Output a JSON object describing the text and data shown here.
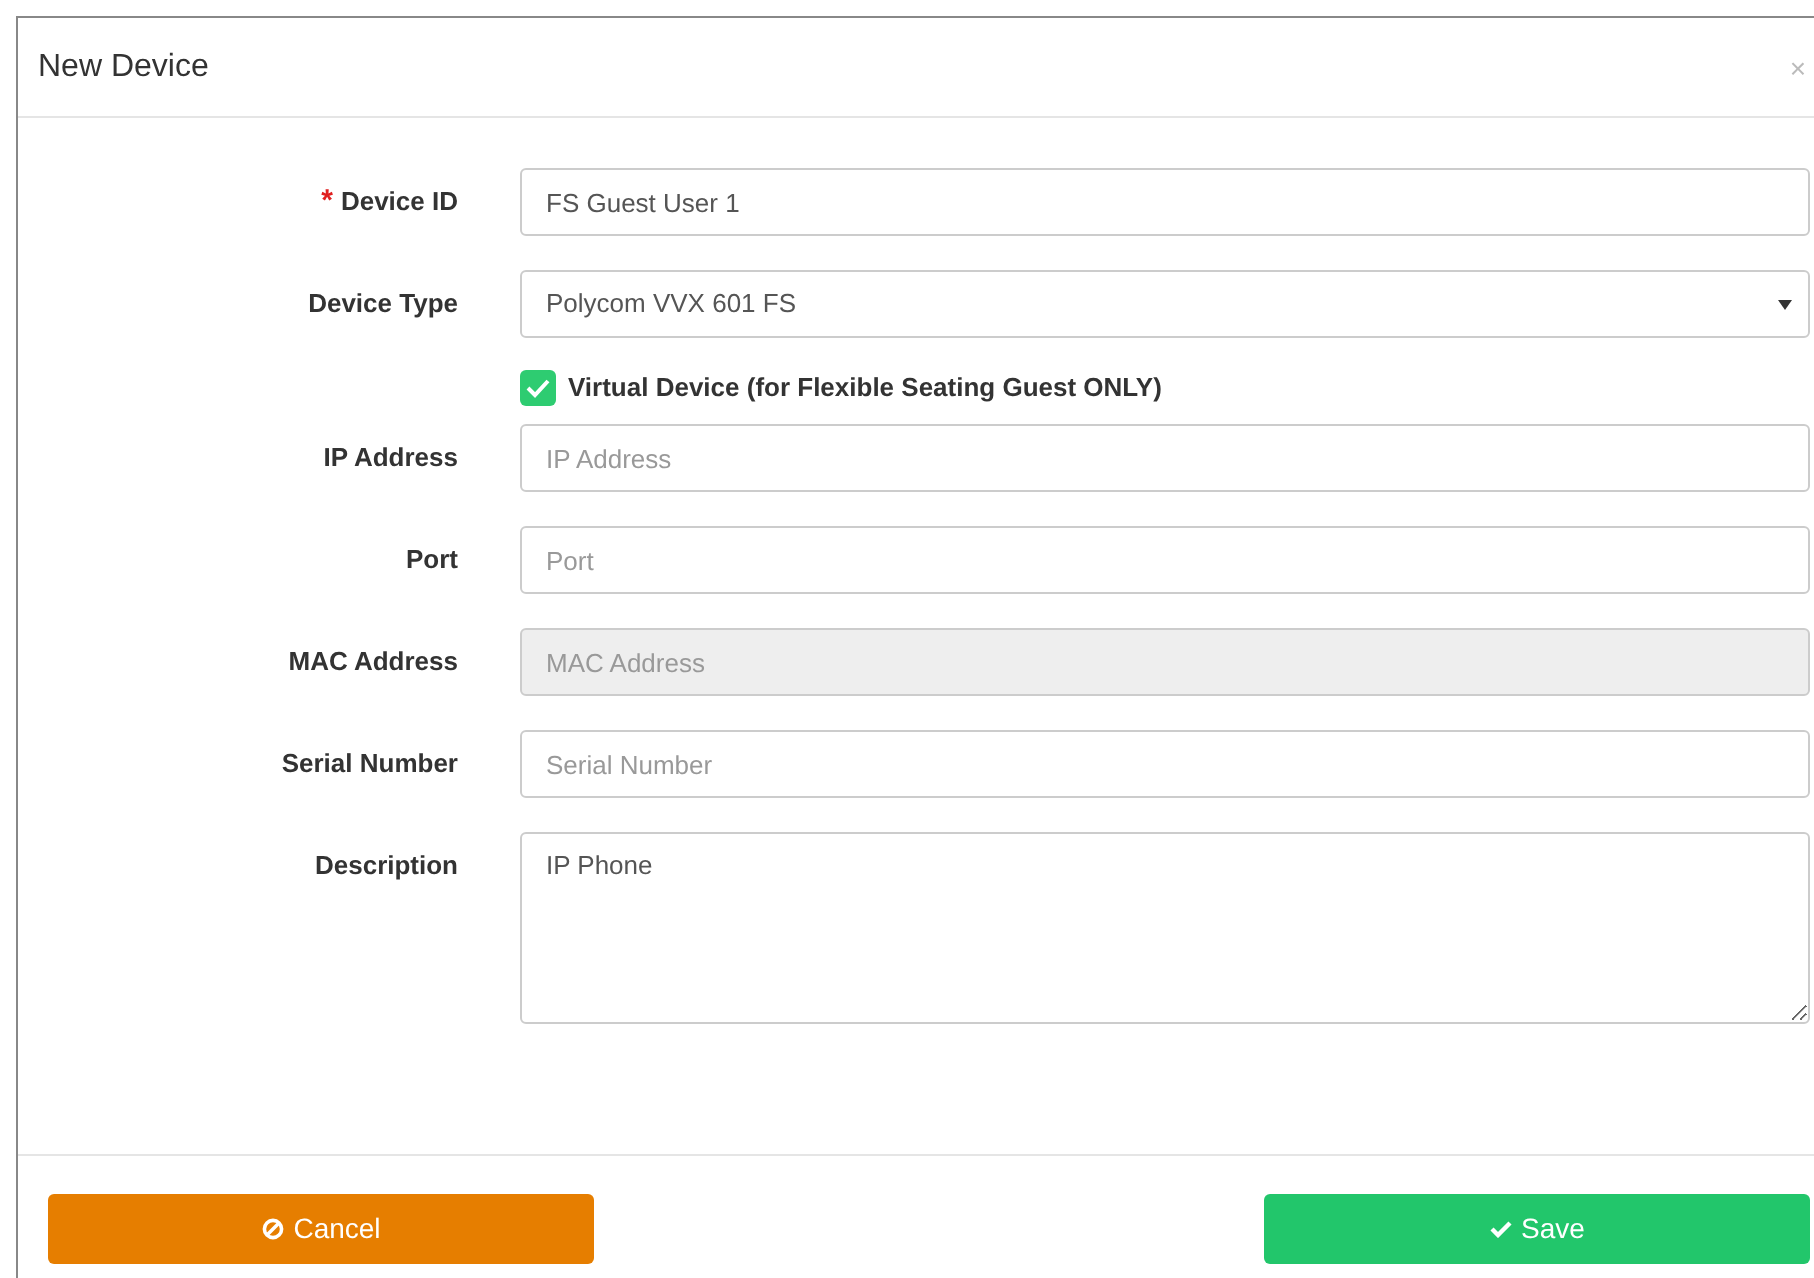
{
  "dialog": {
    "title": "New Device",
    "close": "×"
  },
  "fields": [
    {
      "kind": "text",
      "label": "Device ID",
      "required_mark": "*",
      "disabled": false,
      "value": "FS Guest User 1"
    },
    {
      "kind": "select",
      "label": "Device Type",
      "disabled": false,
      "value": "Polycom VVX 601 FS"
    },
    {
      "kind": "checkbox",
      "label": "Virtual Device (for Flexible Seating Guest ONLY)",
      "checked": true
    },
    {
      "kind": "text",
      "label": "IP Address",
      "disabled": false,
      "placeholder": "IP Address"
    },
    {
      "kind": "text",
      "label": "Port",
      "disabled": false,
      "placeholder": "Port"
    },
    {
      "kind": "text",
      "label": "MAC Address",
      "disabled": true,
      "placeholder": "MAC Address"
    },
    {
      "kind": "text",
      "label": "Serial Number",
      "disabled": false,
      "placeholder": "Serial Number"
    },
    {
      "kind": "textarea",
      "label": "Description",
      "disabled": false,
      "value": "IP Phone"
    }
  ],
  "buttons": [
    {
      "kind": "cancel",
      "label": "Cancel"
    },
    {
      "kind": "save",
      "label": "Save"
    }
  ]
}
